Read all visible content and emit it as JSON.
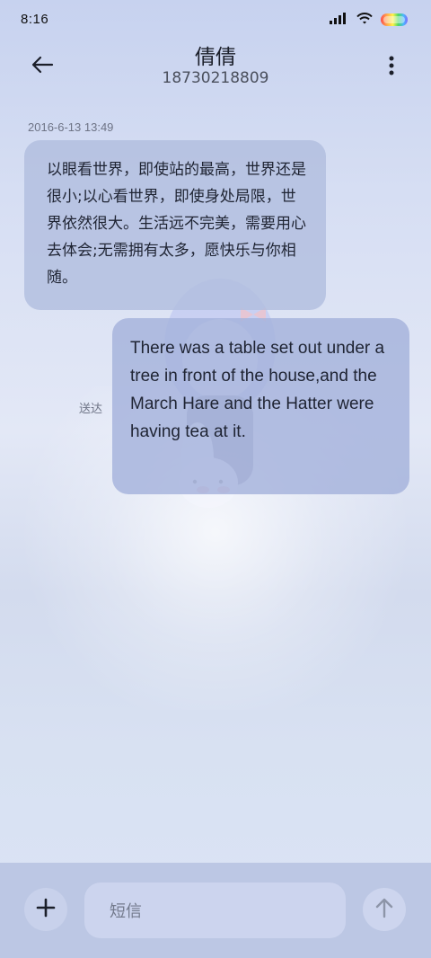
{
  "status_bar": {
    "time": "8:16",
    "icons": [
      "signal-icon",
      "wifi-icon",
      "battery-icon"
    ]
  },
  "header": {
    "contact_name": "倩倩",
    "phone_number": "18730218809",
    "back_icon": "back-arrow-icon",
    "menu_icon": "more-vertical-icon"
  },
  "conversation": {
    "timestamp": "2016-6-13 13:49",
    "incoming_message": "以眼看世界，即使站的最高，世界还是很小;以心看世界，即使身处局限，世界依然很大。生活远不完美，需要用心去体会;无需拥有太多，愿快乐与你相随。",
    "outgoing_message": "There was a table set out under a tree in front of the house,and the March Hare and the Hatter were having tea at it.",
    "delivery_status": "送达"
  },
  "composer": {
    "placeholder": "短信",
    "add_icon": "plus-icon",
    "send_icon": "arrow-up-icon"
  },
  "colors": {
    "bubble": "#AFBCDE",
    "composer": "#B6C2E0",
    "text": "#1F2433"
  }
}
